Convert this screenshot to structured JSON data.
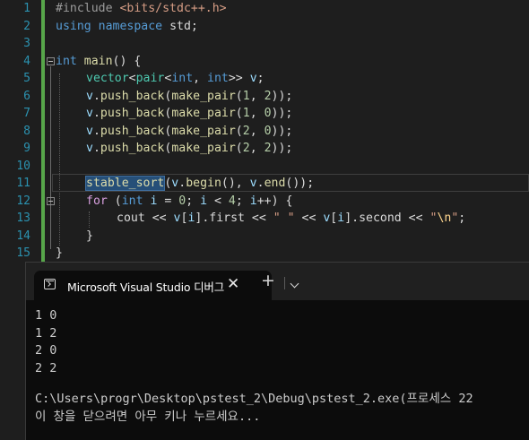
{
  "editor": {
    "line_numbers": [
      "1",
      "2",
      "3",
      "4",
      "5",
      "6",
      "7",
      "8",
      "9",
      "10",
      "11",
      "12",
      "13",
      "14",
      "15"
    ],
    "code": {
      "l1_directive": "#include",
      "l1_header": "<bits/stdc++.h>",
      "l2_using": "using",
      "l2_namespace": "namespace",
      "l2_std": "std;",
      "l4_int": "int",
      "l4_main": "main",
      "l4_rest": "() {",
      "l5_vector": "vector",
      "l5_lt": "<",
      "l5_pair": "pair",
      "l5_lt2": "<",
      "l5_int1": "int",
      "l5_comma": ", ",
      "l5_int2": "int",
      "l5_gt": ">> ",
      "l5_v": "v",
      "l5_semi": ";",
      "push_lines": [
        {
          "obj": "v",
          "dot": ".",
          "fn": "push_back",
          "open": "(",
          "mk": "make_pair",
          "p": "(",
          "a": "1",
          "c": ", ",
          "b": "2",
          "close": "));"
        },
        {
          "obj": "v",
          "dot": ".",
          "fn": "push_back",
          "open": "(",
          "mk": "make_pair",
          "p": "(",
          "a": "1",
          "c": ", ",
          "b": "0",
          "close": "));"
        },
        {
          "obj": "v",
          "dot": ".",
          "fn": "push_back",
          "open": "(",
          "mk": "make_pair",
          "p": "(",
          "a": "2",
          "c": ", ",
          "b": "0",
          "close": "));"
        },
        {
          "obj": "v",
          "dot": ".",
          "fn": "push_back",
          "open": "(",
          "mk": "make_pair",
          "p": "(",
          "a": "2",
          "c": ", ",
          "b": "2",
          "close": "));"
        }
      ],
      "l11_fn": "stable_sort",
      "l11_open": "(",
      "l11_v1": "v",
      "l11_dot1": ".",
      "l11_begin": "begin",
      "l11_mid": "(), ",
      "l11_v2": "v",
      "l11_dot2": ".",
      "l11_end": "end",
      "l11_close": "());",
      "l12_for": "for",
      "l12_open": " (",
      "l12_int": "int",
      "l12_i1": " i",
      "l12_eq": " = ",
      "l12_zero": "0",
      "l12_semi1": "; ",
      "l12_i2": "i",
      "l12_lt": " < ",
      "l12_four": "4",
      "l12_semi2": "; ",
      "l12_i3": "i",
      "l12_inc": "++) {",
      "l13_cout": "cout",
      "l13_op1": " << ",
      "l13_v1": "v",
      "l13_b1": "[",
      "l13_i1": "i",
      "l13_b2": "].",
      "l13_first": "first",
      "l13_op2": " << ",
      "l13_space": "\" \"",
      "l13_op3": " << ",
      "l13_v2": "v",
      "l13_b3": "[",
      "l13_i2": "i",
      "l13_b4": "].",
      "l13_second": "second",
      "l13_op4": " << ",
      "l13_q1": "\"",
      "l13_nl": "\\n",
      "l13_q2": "\"",
      "l13_semi": ";",
      "l14_brace": "}",
      "l15_brace": "}"
    }
  },
  "console": {
    "tab_title": "Microsoft Visual Studio 디버그",
    "tab_close": "✕",
    "new_tab": "+",
    "output_lines": [
      "1 0",
      "1 2",
      "2 0",
      "2 2"
    ],
    "exit_line": "C:\\Users\\progr\\Desktop\\pstest_2\\Debug\\pstest_2.exe(프로세스 22",
    "press_key_line": "이 창을 닫으려면 아무 키나 누르세요..."
  },
  "colors": {
    "background": "#1e1e1e",
    "line_number": "#2b91af",
    "keyword": "#569cd6",
    "type": "#4ec9b0",
    "function": "#dcdcaa",
    "variable": "#9cdcfe",
    "number": "#b5cea8",
    "string": "#d69d85",
    "change_bar": "#57a64a",
    "console_bg": "#0c0c0c"
  }
}
